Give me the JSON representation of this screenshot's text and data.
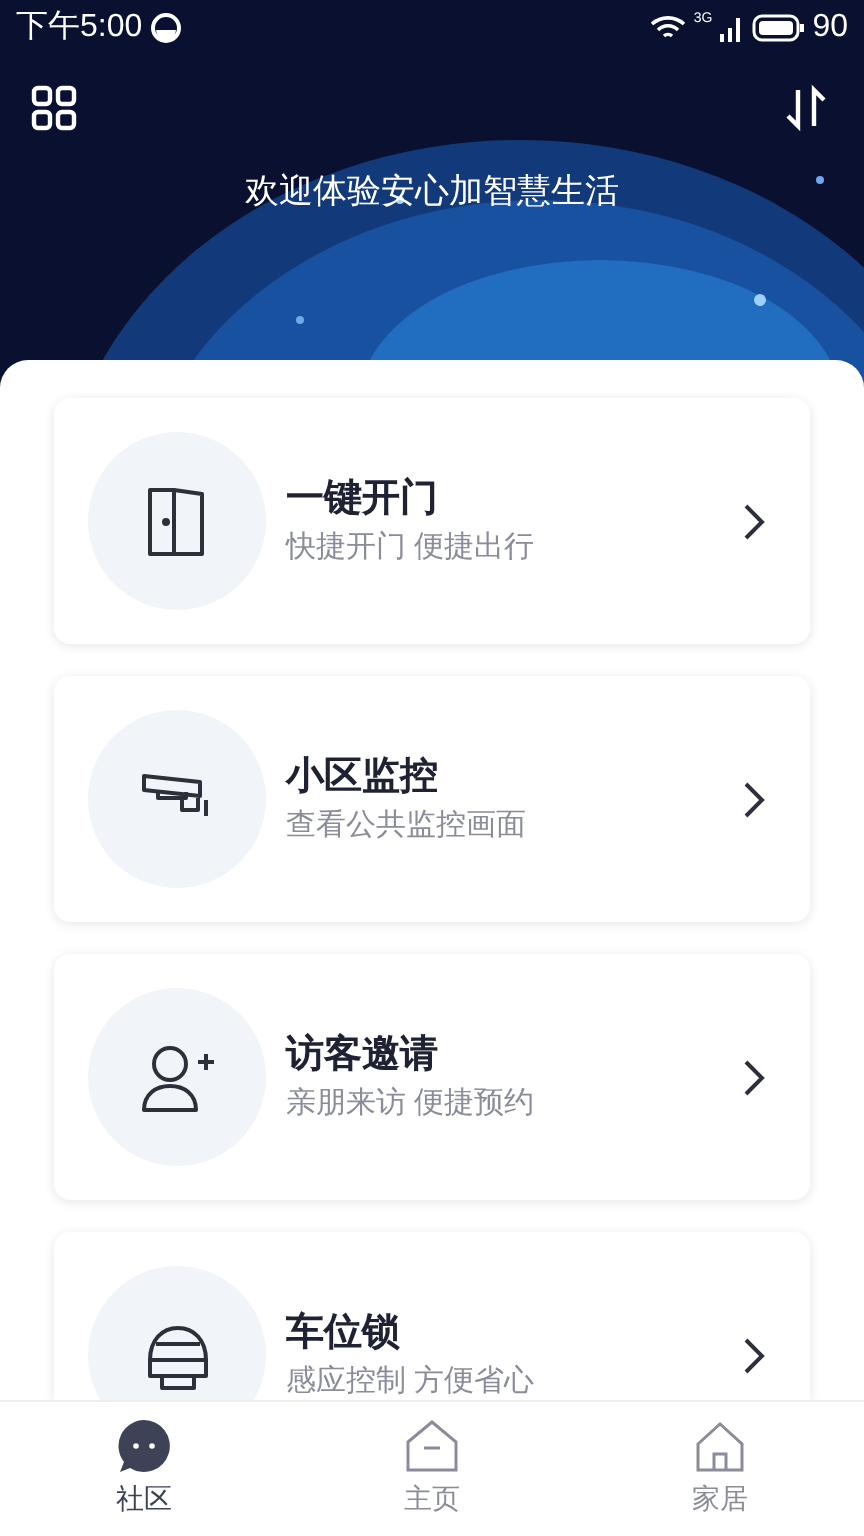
{
  "status_bar": {
    "time": "下午5:00",
    "network": "3G",
    "battery": "90"
  },
  "header": {
    "title": "欢迎体验安心加智慧生活"
  },
  "features": [
    {
      "kind": "door",
      "title": "一键开门",
      "subtitle": "快捷开门 便捷出行"
    },
    {
      "kind": "camera",
      "title": "小区监控",
      "subtitle": "查看公共监控画面"
    },
    {
      "kind": "visitor",
      "title": "访客邀请",
      "subtitle": "亲朋来访 便捷预约"
    },
    {
      "kind": "parking",
      "title": "车位锁",
      "subtitle": "感应控制 方便省心"
    }
  ],
  "tabs": [
    {
      "kind": "chat",
      "label": "社区",
      "selected": true
    },
    {
      "kind": "home",
      "label": "主页",
      "selected": false
    },
    {
      "kind": "house",
      "label": "家居",
      "selected": false
    }
  ]
}
